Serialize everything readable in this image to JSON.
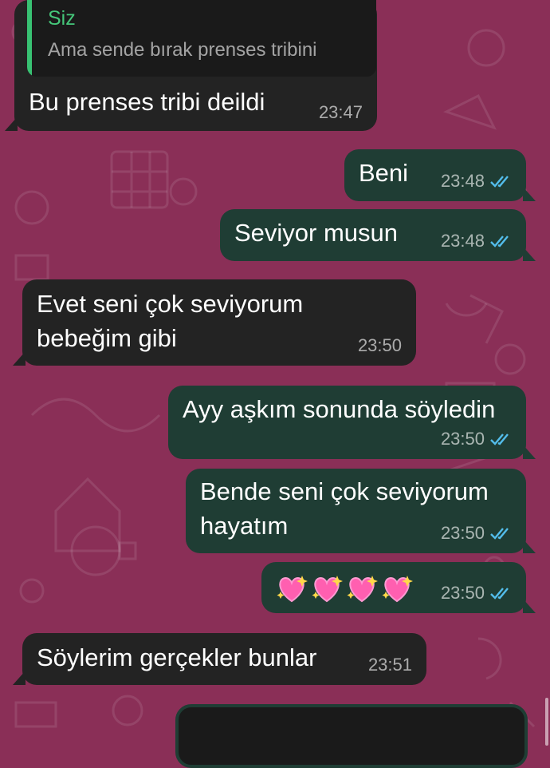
{
  "colors": {
    "wallpaper": "#8a2f57",
    "incoming_bubble": "#232323",
    "outgoing_bubble": "#1f3d34",
    "quote_accent": "#38c172",
    "read_ticks": "#53bdeb"
  },
  "messages": [
    {
      "direction": "in",
      "quote": {
        "author": "Siz",
        "text": "Ama sende bırak prenses tribini"
      },
      "text": "Bu prenses tribi deildi",
      "time": "23:47"
    },
    {
      "direction": "out",
      "text": "Beni",
      "time": "23:48",
      "status": "read-double-check-icon"
    },
    {
      "direction": "out",
      "text": "Seviyor musun",
      "time": "23:48",
      "status": "read-double-check-icon"
    },
    {
      "direction": "in",
      "line1": "Evet seni çok seviyorum",
      "line2": "bebeğim gibi",
      "time": "23:50"
    },
    {
      "direction": "out",
      "text": "Ayy aşkım sonunda söyledin",
      "time": "23:50",
      "status": "read-double-check-icon"
    },
    {
      "direction": "out",
      "line1": "Bende seni çok seviyorum",
      "line2": "hayatım",
      "time": "23:50",
      "status": "read-double-check-icon"
    },
    {
      "direction": "out",
      "emoji": "sparkling-heart-icon",
      "emoji_count": 4,
      "time": "23:50",
      "status": "read-double-check-icon"
    },
    {
      "direction": "in",
      "text": "Söylerim gerçekler bunlar",
      "time": "23:51"
    },
    {
      "direction": "out",
      "media": "media-preview"
    }
  ]
}
